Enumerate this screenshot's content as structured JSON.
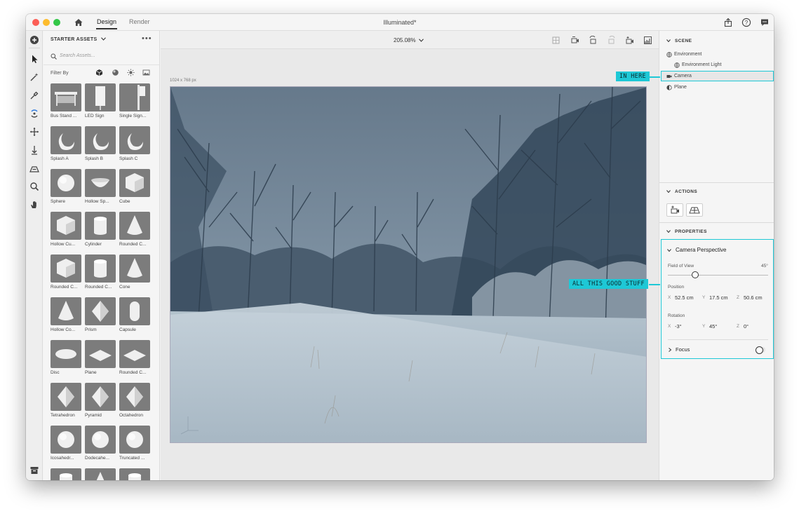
{
  "titlebar": {
    "tabs": [
      {
        "label": "Design"
      },
      {
        "label": "Render"
      }
    ],
    "document_title": "Illuminated*"
  },
  "assets": {
    "header": "STARTER ASSETS",
    "more": "•••",
    "search_placeholder": "Search Assets...",
    "filter_label": "Filter By",
    "items": [
      {
        "label": "Bus Stand ...",
        "shape": "bus-stand"
      },
      {
        "label": "LED Sign",
        "shape": "led-sign"
      },
      {
        "label": "Single Sign...",
        "shape": "single-sign"
      },
      {
        "label": "Splash A",
        "shape": "splash"
      },
      {
        "label": "Splash B",
        "shape": "splash"
      },
      {
        "label": "Splash C",
        "shape": "splash"
      },
      {
        "label": "Sphere",
        "shape": "sphere"
      },
      {
        "label": "Hollow Sp...",
        "shape": "bowl"
      },
      {
        "label": "Cube",
        "shape": "cube"
      },
      {
        "label": "Hollow Cu...",
        "shape": "cube"
      },
      {
        "label": "Cylinder",
        "shape": "cylinder"
      },
      {
        "label": "Rounded C...",
        "shape": "cone"
      },
      {
        "label": "Rounded C...",
        "shape": "cube"
      },
      {
        "label": "Rounded C...",
        "shape": "cylinder"
      },
      {
        "label": "Cone",
        "shape": "cone"
      },
      {
        "label": "Hollow Co...",
        "shape": "cone"
      },
      {
        "label": "Prism",
        "shape": "prism"
      },
      {
        "label": "Capsule",
        "shape": "capsule"
      },
      {
        "label": "Disc",
        "shape": "disc"
      },
      {
        "label": "Plane",
        "shape": "plane"
      },
      {
        "label": "Rounded C...",
        "shape": "plane"
      },
      {
        "label": "Tetrahedron",
        "shape": "prism"
      },
      {
        "label": "Pyramid",
        "shape": "prism"
      },
      {
        "label": "Octahedron",
        "shape": "prism"
      },
      {
        "label": "Icosahedr...",
        "shape": "sphere"
      },
      {
        "label": "Dodecahe...",
        "shape": "sphere"
      },
      {
        "label": "Truncated ...",
        "shape": "sphere"
      },
      {
        "label": "",
        "shape": "cylinder"
      },
      {
        "label": "",
        "shape": "cone"
      },
      {
        "label": "",
        "shape": "cylinder"
      }
    ]
  },
  "viewport": {
    "zoom": "205.08%",
    "canvas_size": "1024 x 768 px"
  },
  "scene": {
    "title": "SCENE",
    "items": [
      {
        "label": "Environment",
        "icon": "globe-icon"
      },
      {
        "label": "Environment Light",
        "icon": "globe-icon"
      },
      {
        "label": "Camera",
        "icon": "camera-icon"
      },
      {
        "label": "Plane",
        "icon": "plane-icon"
      }
    ]
  },
  "actions": {
    "title": "ACTIONS"
  },
  "properties": {
    "title": "PROPERTIES",
    "group_title": "Camera Perspective",
    "fov_label": "Field of View",
    "fov_value": "45°",
    "fov_fraction": 0.27,
    "position_label": "Position",
    "position": {
      "x_axis": "X",
      "x": "52.5 cm",
      "y_axis": "Y",
      "y": "17.5 cm",
      "z_axis": "Z",
      "z": "50.6 cm"
    },
    "rotation_label": "Rotation",
    "rotation": {
      "x_axis": "X",
      "x": "-3°",
      "y_axis": "Y",
      "y": "45°",
      "z_axis": "Z",
      "z": "0°"
    },
    "focus_label": "Focus"
  },
  "annotations": {
    "in_here": "IN HERE",
    "all_this": "ALL THIS GOOD STUFF",
    "accent_color": "#1ec8d6"
  }
}
